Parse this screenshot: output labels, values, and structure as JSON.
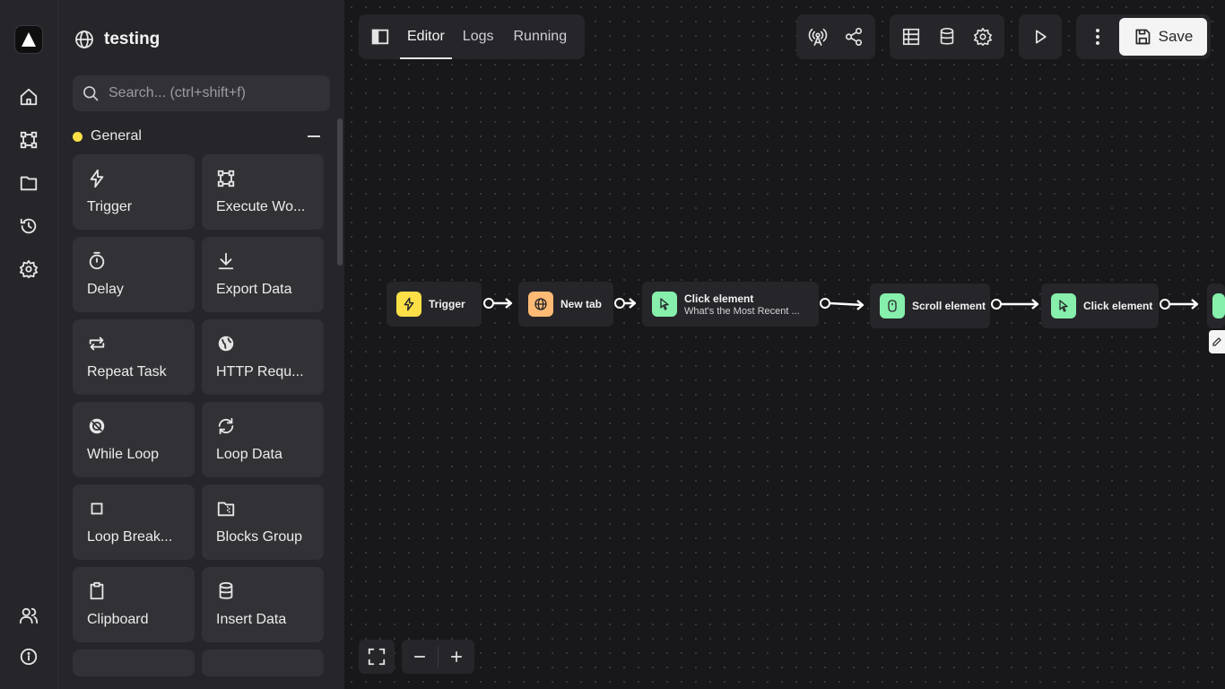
{
  "workflow": {
    "title": "testing"
  },
  "search": {
    "placeholder": "Search... (ctrl+shift+f)"
  },
  "category": {
    "label": "General",
    "color": "#fde047"
  },
  "blocks": [
    {
      "label": "Trigger",
      "icon": "lightning-icon"
    },
    {
      "label": "Execute Wo...",
      "icon": "workflow-icon"
    },
    {
      "label": "Delay",
      "icon": "timer-icon"
    },
    {
      "label": "Export Data",
      "icon": "download-icon"
    },
    {
      "label": "Repeat Task",
      "icon": "repeat-icon"
    },
    {
      "label": "HTTP Requ...",
      "icon": "globe-icon"
    },
    {
      "label": "While Loop",
      "icon": "while-loop-icon"
    },
    {
      "label": "Loop Data",
      "icon": "loop-icon"
    },
    {
      "label": "Loop Break...",
      "icon": "stop-square-icon"
    },
    {
      "label": "Blocks Group",
      "icon": "folder-zip-icon"
    },
    {
      "label": "Clipboard",
      "icon": "clipboard-icon"
    },
    {
      "label": "Insert Data",
      "icon": "database-icon"
    }
  ],
  "tabs": {
    "editor": "Editor",
    "logs": "Logs",
    "running": "Running"
  },
  "toolbar": {
    "save_label": "Save"
  },
  "nodes": {
    "trigger": {
      "label": "Trigger",
      "color": "#fde047"
    },
    "new_tab": {
      "label": "New tab",
      "color": "#fdba74"
    },
    "click1": {
      "label": "Click element",
      "sub": "What's the Most Recent ...",
      "color": "#86efac"
    },
    "scroll": {
      "label": "Scroll element",
      "color": "#86efac"
    },
    "click2": {
      "label": "Click element",
      "color": "#86efac"
    }
  }
}
